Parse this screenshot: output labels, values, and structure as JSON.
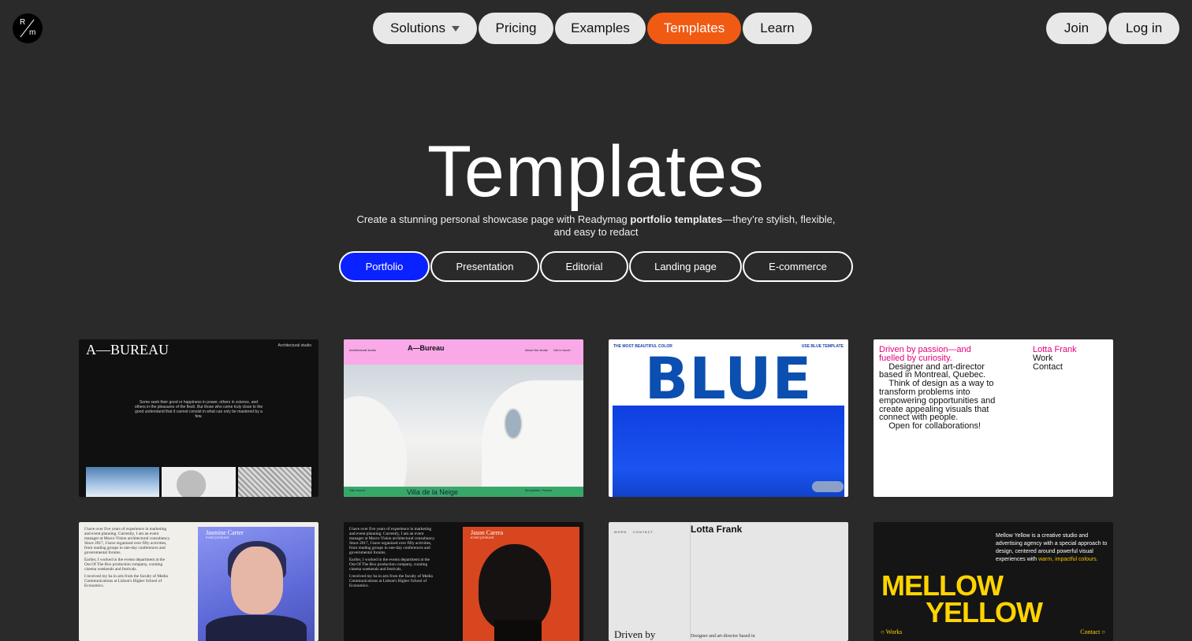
{
  "logo": {
    "top": "R",
    "bottom": "m"
  },
  "nav": {
    "solutions": "Solutions",
    "pricing": "Pricing",
    "examples": "Examples",
    "templates": "Templates",
    "learn": "Learn",
    "join": "Join",
    "login": "Log in"
  },
  "hero": {
    "title": "Templates",
    "subtitle_pre": "Create a stunning personal showcase page with Readymag ",
    "subtitle_bold": "portfolio templates",
    "subtitle_post": "—they’re stylish, flexible, and easy to redact"
  },
  "categories": [
    "Portfolio",
    "Presentation",
    "Editorial",
    "Landing page",
    "E-commerce"
  ],
  "active_category": "Portfolio",
  "cards": {
    "abureau_dark": {
      "title": "A—BUREAU",
      "tag": "Architectural studio",
      "para": "Some seek their good or happiness in power, others in science, and others in the pleasures of the flesh. But those who come truly close to the good understand that it cannot consist in what can only be mastered by a few."
    },
    "abureau_pink": {
      "studio": "Architectural studio",
      "title": "A—Bureau",
      "about": "About the studio",
      "contact": "Get in touch",
      "foot_left": "Villa record",
      "foot_title": "Villa de la Neige",
      "foot_right": "Montpellier, France"
    },
    "blue": {
      "left": "THE MOST BEAUTIFUL COLOR",
      "right": "USE BLUE TEMPLATE",
      "big": "BLUE"
    },
    "lotta_white": {
      "line1": "Driven by passion—and fuelled by curiosity.",
      "line2": "Designer and art-director based in Montreal, Quebec.",
      "line3": "Think of design as a way to transform problems into empowering opportunities and create appealing visuals that connect with people.",
      "line4": "Open for collaborations!",
      "name": "Lotta Frank",
      "work": "Work",
      "contact": "Contact"
    },
    "jasmine": {
      "bio1": "I have over five years of experience in marketing and event planning. Currently, I am an event manager at Macro Vision architectural consultancy. Since 2017, I have organized over fifty activities, from reading groups to one-day conferences and governmental forums.",
      "bio2": "Earlier, I worked in the events department at the Out Of The Box production company, curating cinema weekends and festivals.",
      "bio3": "I received my ba in arts from the faculty of Media Communications at Lisbon's Higher School of Economics.",
      "name": "Jasmine Carter",
      "role": "event producer"
    },
    "jason": {
      "bio1": "I have over five years of experience in marketing and event planning. Currently, I am an event manager at Macro Vision architectural consultancy. Since 2017, I have organized over fifty activities, from reading groups to one-day conferences and governmental forums.",
      "bio2": "Earlier, I worked in the events department at the Out Of The Box production company, curating cinema weekends and festivals.",
      "bio3": "I received my ba in arts from the faculty of Media Communications at Lisbon's Higher School of Economics.",
      "name": "Jason Carera",
      "role": "event producer"
    },
    "lotta_grey": {
      "nav_work": "WORK",
      "nav_contact": "CONTACT",
      "name": "Lotta Frank",
      "driven": "Driven by",
      "desc": "Designer and art-director based in"
    },
    "mellow": {
      "text_pre": "Mellow Yellow is a creative studio and advertising agency with a special approach to design, centered around powerful visual experiences with ",
      "text_accent": "warm, impactful colours.",
      "line1": "MELLOW",
      "line2": "YELLOW",
      "works": "○ Works",
      "contact": "Contact ○"
    }
  },
  "colors": {
    "background": "#2a2a2a",
    "accent_orange": "#f05a13",
    "accent_blue": "#0a22ff"
  }
}
